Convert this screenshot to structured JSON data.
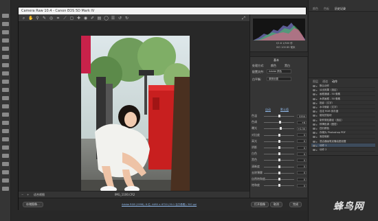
{
  "window": {
    "title": "Camera Raw 10.4  -  Canon EOS 5D Mark IV"
  },
  "ps_panels": {
    "tabs": [
      "颜色",
      "色板",
      "历史记录"
    ],
    "actions_tabs": [
      "图层",
      "通道",
      "动作"
    ],
    "action_items": [
      "默认动作",
      "淡出效果（选区）",
      "画框通道 - 50 像素",
      "木质画框 - 50 像素",
      "投影（文字）",
      "水中倒影（文字）",
      "自定 RGB 到灰度",
      "熔化的铅块",
      "制作剪贴路径（选区）",
      "棕褐色调（图层）",
      "四分颜色",
      "存储为 Photoshop PDF",
      "渐变映射",
      "混合器画笔克隆绘图设置",
      "动作 1",
      "动作 2"
    ],
    "active_action": 14
  },
  "camera_raw": {
    "panel_title": "基本",
    "profile_label": "处理方式:",
    "profile_options": [
      "颜色",
      "黑白"
    ],
    "profile_row": "配置文件:",
    "profile_value": "Adobe 颜色",
    "wb_label": "白平衡:",
    "wb_value": "原照设置",
    "auto_label": "自动",
    "default_label": "默认值",
    "sliders": [
      {
        "name": "色温",
        "value": "5350",
        "level": 0.52
      },
      {
        "name": "色调",
        "value": "+6",
        "level": 0.53
      },
      {
        "name": "曝光",
        "value": "+0.30",
        "level": 0.55
      },
      {
        "name": "对比度",
        "value": "0",
        "level": 0.5
      },
      {
        "name": "高光",
        "value": "0",
        "level": 0.5
      },
      {
        "name": "阴影",
        "value": "0",
        "level": 0.5
      },
      {
        "name": "白色",
        "value": "0",
        "level": 0.5
      },
      {
        "name": "黑色",
        "value": "0",
        "level": 0.5
      },
      {
        "name": "清晰度",
        "value": "0",
        "level": 0.5
      },
      {
        "name": "去除薄雾",
        "value": "0",
        "level": 0.5
      },
      {
        "name": "自然饱和度",
        "value": "0",
        "level": 0.5
      },
      {
        "name": "饱和度",
        "value": "0",
        "level": 0.5
      }
    ],
    "camera_info": {
      "line1": "f/2.8  1/500 秒",
      "line2": "ISO 100  85 毫米"
    },
    "zoom": "适合视图",
    "filename": "IMG_1100.CR2",
    "info_line": "Adobe RGB (1998); 8 位; 4480 × 6720 (30.1 百万像素); 300 ppi",
    "save_button": "存储图像...",
    "open_button": "打开图像",
    "cancel_button": "取消",
    "done_button": "完成"
  },
  "watermark": "蜂鸟网"
}
